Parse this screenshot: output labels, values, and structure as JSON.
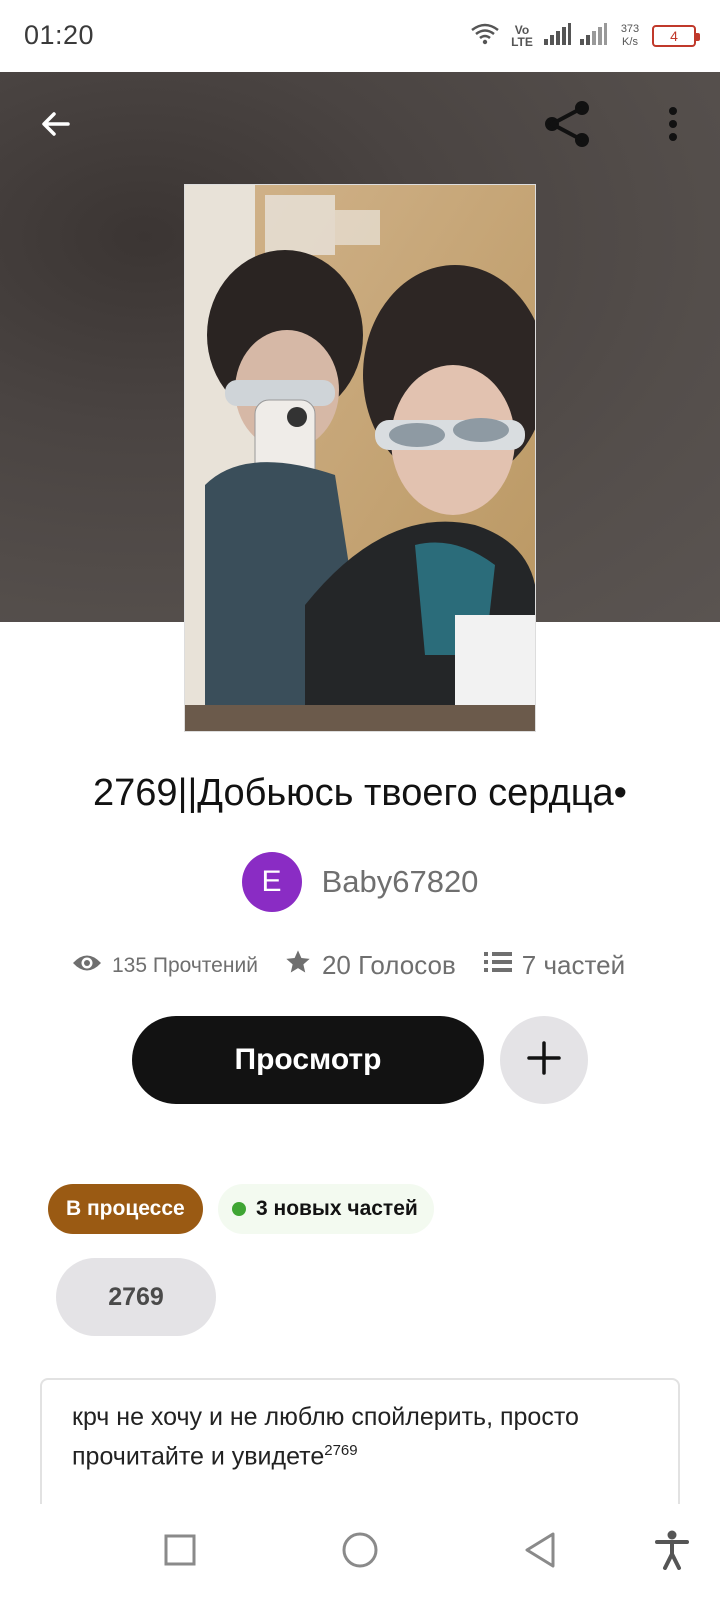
{
  "status_bar": {
    "time": "01:20",
    "network_label": "Vo LTE",
    "net_speed_value": "373",
    "net_speed_unit": "K/s",
    "battery": "4"
  },
  "header": {
    "back_icon": "arrow-left-icon",
    "share_icon": "share-icon",
    "more_icon": "more-vertical-icon"
  },
  "story": {
    "title": "2769||Добьюсь твоего сердца•",
    "author_initial": "E",
    "author_name": "Baby67820",
    "reads": "135 Прочтений",
    "votes": "20 Голосов",
    "parts": "7 частей",
    "read_button": "Просмотр",
    "status": "В процессе",
    "new_parts": "3 новых частей",
    "tag": "2769",
    "description": "крч не хочу и не люблю спойлерить, просто прочитайте и увидете",
    "description_sup": "2769"
  },
  "colors": {
    "accent_dark": "#121212",
    "status_brown": "#9a5a13",
    "avatar_purple": "#8a2cc4",
    "new_dot_green": "#3fa534"
  },
  "nav_bar": {
    "square_icon": "recent-apps-icon",
    "circle_icon": "home-icon",
    "triangle_icon": "back-icon",
    "accessibility_icon": "accessibility-icon"
  }
}
